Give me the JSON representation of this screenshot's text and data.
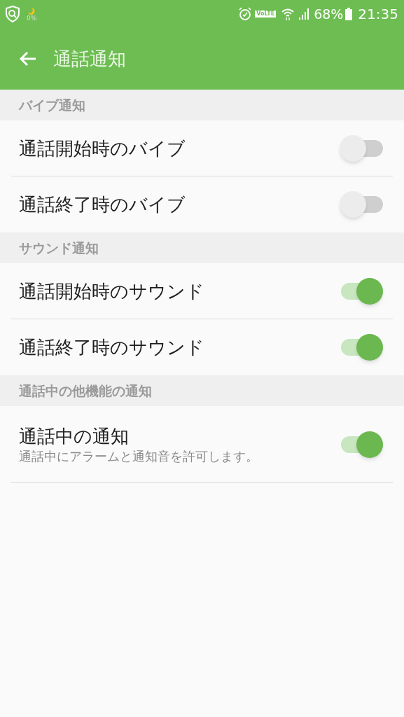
{
  "status_bar": {
    "left_badge": "0%",
    "volte": "VoLTE",
    "battery": "68%",
    "time": "21:35"
  },
  "app_bar": {
    "title": "通話通知"
  },
  "sections": [
    {
      "header": "バイブ通知",
      "items": [
        {
          "title": "通話開始時のバイブ",
          "on": false
        },
        {
          "title": "通話終了時のバイブ",
          "on": false
        }
      ]
    },
    {
      "header": "サウンド通知",
      "items": [
        {
          "title": "通話開始時のサウンド",
          "on": true
        },
        {
          "title": "通話終了時のサウンド",
          "on": true
        }
      ]
    },
    {
      "header": "通話中の他機能の通知",
      "items": [
        {
          "title": "通話中の通知",
          "summary": "通話中にアラームと通知音を許可します。",
          "on": true
        }
      ]
    }
  ]
}
